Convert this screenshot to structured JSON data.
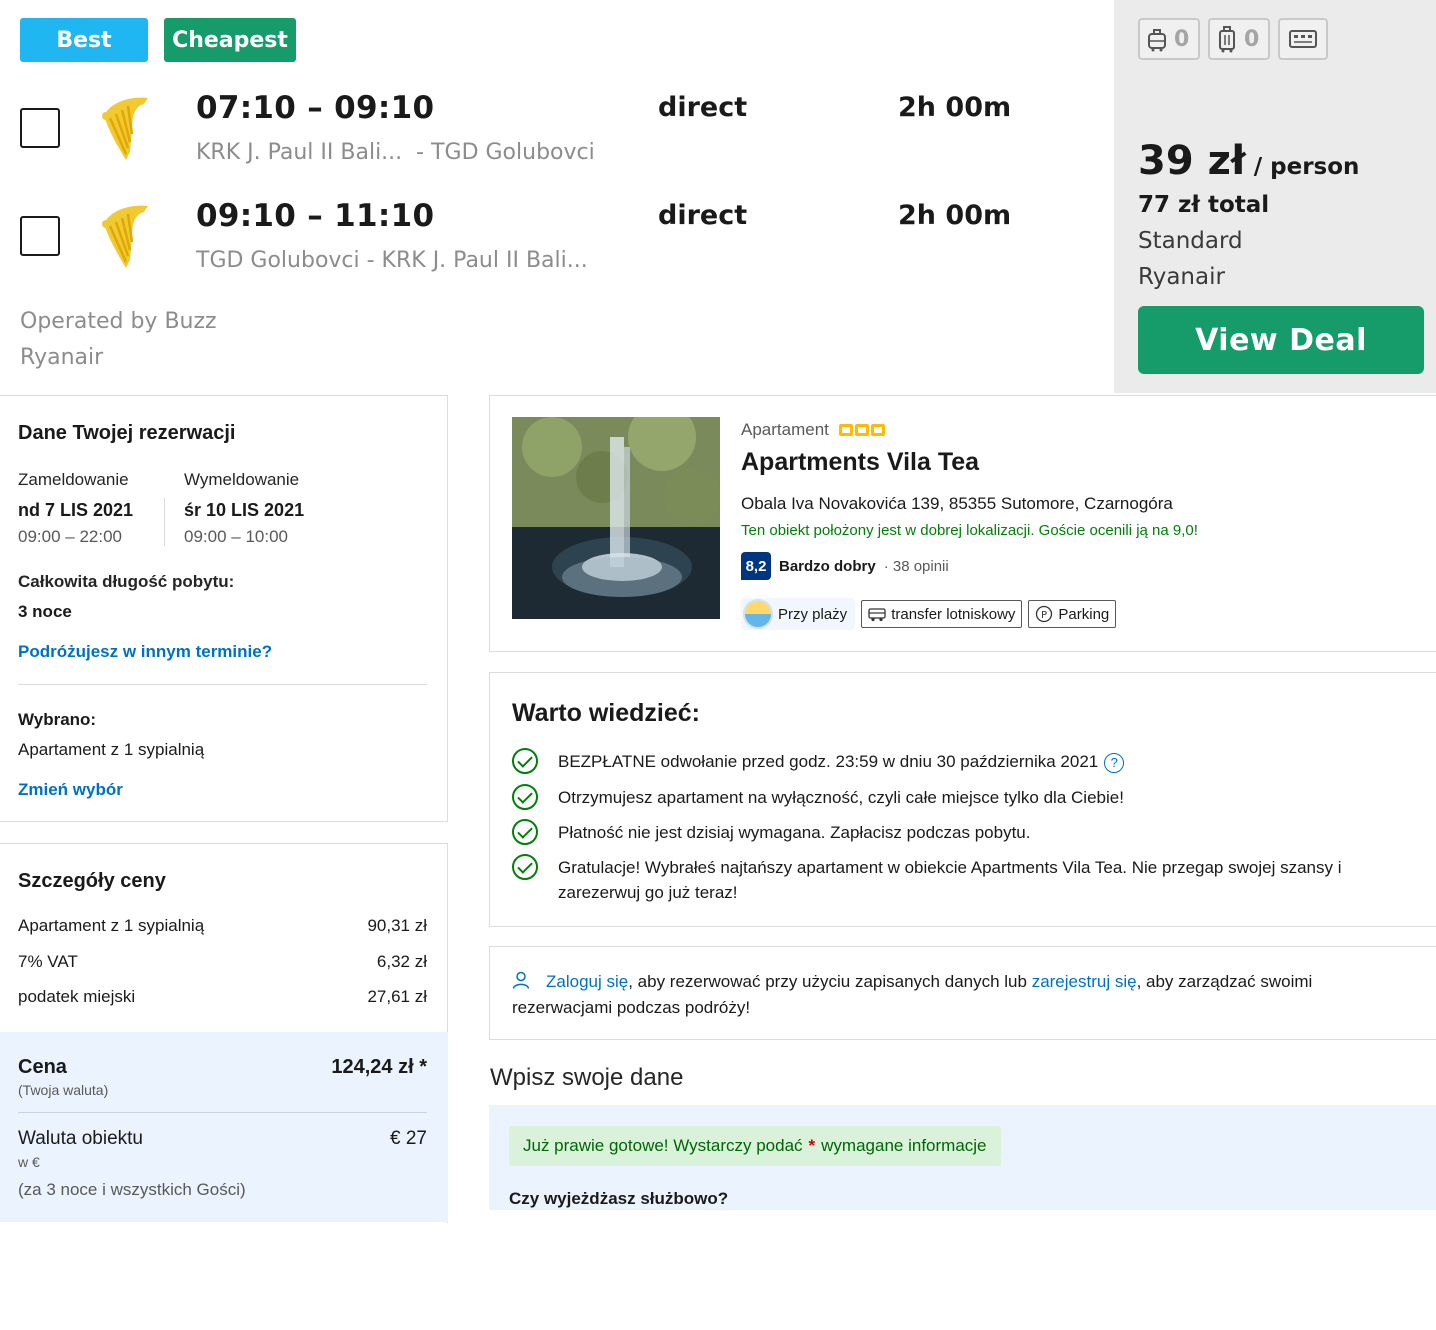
{
  "flight": {
    "tags": {
      "best": "Best",
      "cheapest": "Cheapest"
    },
    "legs": [
      {
        "times": "07:10 – 09:10",
        "route": "KRK J. Paul II Bali...  - TGD Golubovci",
        "stops": "direct",
        "duration": "2h 00m"
      },
      {
        "times": "09:10 – 11:10",
        "route": "TGD Golubovci - KRK J. Paul II Bali...",
        "stops": "direct",
        "duration": "2h 00m"
      }
    ],
    "operated_line1": "Operated by Buzz",
    "operated_line2": "Ryanair",
    "bags": {
      "carry_on": "0",
      "checked": "0"
    },
    "price": {
      "amount": "39 zł",
      "per": "/ person",
      "total": "77 zł total",
      "fare": "Standard",
      "airline": "Ryanair",
      "cta": "View Deal"
    },
    "colors": {
      "best": "#1fb6f2",
      "cheapest": "#169c6a",
      "deal": "#169c6a"
    }
  },
  "reservation": {
    "title": "Dane Twojej rezerwacji",
    "checkin": {
      "label": "Zameldowanie",
      "date": "nd 7 LIS 2021",
      "hours": "09:00 – 22:00"
    },
    "checkout": {
      "label": "Wymeldowanie",
      "date": "śr 10 LIS 2021",
      "hours": "09:00 – 10:00"
    },
    "stay_label": "Całkowita długość pobytu:",
    "stay_value": "3 noce",
    "other_dates_link": "Podróżujesz w innym terminie?",
    "selected_label": "Wybrano:",
    "selected_value": "Apartament z 1 sypialnią",
    "change_link": "Zmień wybór"
  },
  "price_details": {
    "title": "Szczegóły ceny",
    "rows": [
      {
        "label": "Apartament z 1 sypialnią",
        "value": "90,31 zł"
      },
      {
        "label": "7% VAT",
        "value": "6,32 zł"
      },
      {
        "label": "podatek miejski",
        "value": "27,61 zł"
      }
    ],
    "total_label": "Cena",
    "total_sub": "(Twoja waluta)",
    "total_value": "124,24 zł *",
    "prop_currency_label": "Waluta obiektu",
    "prop_currency_sub": "w €",
    "prop_currency_note": "(za 3 noce i wszystkich Gości)",
    "prop_currency_value": "€ 27"
  },
  "property": {
    "type": "Apartament",
    "name": "Apartments Vila Tea",
    "address": "Obala Iva Novakovića 139, 85355 Sutomore, Czarnogóra",
    "location_note": "Ten obiekt położony jest w dobrej lokalizacji. Goście ocenili ją na 9,0!",
    "score": "8,2",
    "score_word": "Bardzo dobry",
    "reviews": "· 38 opinii",
    "chips": {
      "beach": "Przy plaży",
      "transfer": "transfer lotniskowy",
      "parking": "Parking"
    }
  },
  "good_to_know": {
    "title": "Warto wiedzieć:",
    "items": [
      "BEZPŁATNE odwołanie przed godz. 23:59 w dniu 30 października 2021",
      "Otrzymujesz apartament na wyłączność, czyli całe miejsce tylko dla Ciebie!",
      "Płatność nie jest dzisiaj wymagana. Zapłacisz podczas pobytu.",
      "Gratulacje! Wybrałeś najtańszy apartament w obiekcie Apartments Vila Tea. Nie przegap swojej szansy i zarezerwuj go już teraz!"
    ]
  },
  "login": {
    "login_link": "Zaloguj się",
    "text1": ", aby rezerwować przy użyciu zapisanych danych lub ",
    "register_link": "zarejestruj się",
    "text2": ", aby zarządzać swoimi rezerwacjami podczas podróży!"
  },
  "form": {
    "title": "Wpisz swoje dane",
    "almost_text": "Już prawie gotowe! Wystarczy podać",
    "required_mark": "*",
    "almost_text2": "wymagane informacje",
    "business_question": "Czy wyjeżdżasz służbowo?"
  }
}
